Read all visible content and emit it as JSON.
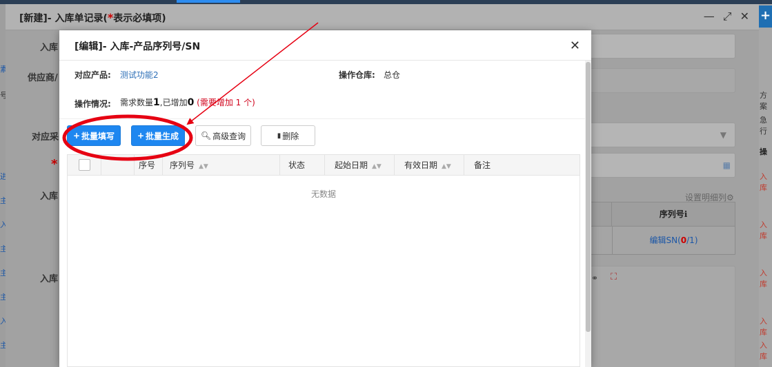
{
  "outer_dialog": {
    "title_prefix": "[新建]- 入库单记录(",
    "required_mark": "*",
    "title_suffix": "表示必填项)",
    "rows": [
      {
        "label": "入库"
      },
      {
        "label": "供应商/"
      },
      {
        "label": "对应采"
      },
      {
        "label": "*"
      },
      {
        "label": "入库"
      },
      {
        "label": "入库"
      }
    ],
    "settings_link": "设置明细列⚙",
    "table": {
      "column_header": "序列号ℹ",
      "cell_prefix": "编辑SN(",
      "cell_done": "0",
      "cell_suffix": "/1)"
    }
  },
  "inner_dialog": {
    "title": "[编辑]- 入库-产品序列号/SN",
    "product_label": "对应产品:",
    "product_value": "测试功能2",
    "warehouse_label": "操作仓库:",
    "warehouse_value": "总仓",
    "status_label": "操作情况:",
    "status_required_text": "需求数量",
    "status_required_num": "1",
    "status_added_text": ",已增加",
    "status_added_num": "0",
    "status_need_text": "(需要增加 1 个)",
    "toolbar": {
      "batch_fill": "批量填写",
      "batch_generate": "批量生成",
      "advanced_search": "高级查询",
      "delete": "删除"
    },
    "grid": {
      "columns": [
        "序号",
        "序列号",
        "状态",
        "起始日期",
        "有效日期",
        "备注"
      ],
      "empty_text": "无数据"
    }
  },
  "background": {
    "left_fragments": [
      "素",
      "号",
      "进",
      "主",
      "入",
      "主",
      "主",
      "主",
      "入",
      "主"
    ],
    "right_fragments": [
      "方案",
      "急行",
      "操",
      "入库",
      "入库",
      "入库",
      "入库",
      "入库"
    ]
  },
  "colors": {
    "primary": "#1e87f0",
    "annotation_red": "#e60012",
    "link": "#2d6fb7"
  }
}
